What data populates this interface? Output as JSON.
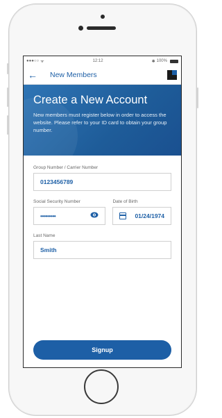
{
  "statusbar": {
    "signal": "●●●○○",
    "wifi": "ᯤ",
    "time": "12:12",
    "bluetooth": "✱",
    "battery": "100%"
  },
  "navbar": {
    "back_icon": "arrow-left-icon",
    "title": "New Members",
    "logo": "brand-logo"
  },
  "hero": {
    "title": "Create a New Account",
    "description": "New members must register below in order to access the website. Please refer to your ID card to obtain your group number."
  },
  "form": {
    "group_number": {
      "label": "Group Number / Carrier Number",
      "value": "0123456789"
    },
    "ssn": {
      "label": "Social Security Number",
      "value": "•••••••••",
      "icon": "eye-icon"
    },
    "dob": {
      "label": "Date of Birth",
      "value": "01/24/1974",
      "icon": "calendar-icon"
    },
    "last_name": {
      "label": "Last Name",
      "value": "Smith"
    }
  },
  "signup_button": {
    "label": "Signup"
  },
  "colors": {
    "accent": "#1d5fa6",
    "hero": "#2f75b5"
  }
}
